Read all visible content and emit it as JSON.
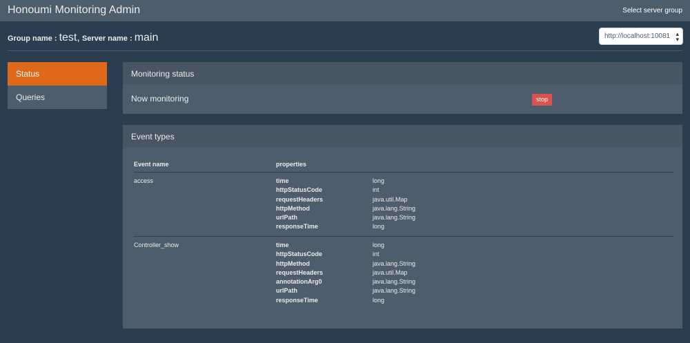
{
  "navbar": {
    "brand": "Honoumi Monitoring Admin",
    "right_link": "Select server group"
  },
  "group": {
    "group_label": "Group name : ",
    "group_value": "test",
    "comma": ",",
    "server_label": "Server name : ",
    "server_value": "main"
  },
  "server_select": {
    "value": "http://localhost:10081"
  },
  "sidebar": {
    "items": [
      {
        "label": "Status",
        "active": true
      },
      {
        "label": "Queries",
        "active": false
      }
    ]
  },
  "monitoring": {
    "title": "Monitoring status",
    "status_text": "Now monitoring",
    "stop_label": "stop"
  },
  "events": {
    "title": "Event types",
    "col_name": "Event name",
    "col_props": "properties",
    "rows": [
      {
        "name": "access",
        "properties": [
          {
            "name": "time",
            "type": "long"
          },
          {
            "name": "httpStatusCode",
            "type": "int"
          },
          {
            "name": "requestHeaders",
            "type": "java.util.Map"
          },
          {
            "name": "httpMethod",
            "type": "java.lang.String"
          },
          {
            "name": "urlPath",
            "type": "java.lang.String"
          },
          {
            "name": "responseTime",
            "type": "long"
          }
        ]
      },
      {
        "name": "Controller_show",
        "properties": [
          {
            "name": "time",
            "type": "long"
          },
          {
            "name": "httpStatusCode",
            "type": "int"
          },
          {
            "name": "httpMethod",
            "type": "java.lang.String"
          },
          {
            "name": "requestHeaders",
            "type": "java.util.Map"
          },
          {
            "name": "annotationArg0",
            "type": "java.lang.String"
          },
          {
            "name": "urlPath",
            "type": "java.lang.String"
          },
          {
            "name": "responseTime",
            "type": "long"
          }
        ]
      }
    ]
  }
}
